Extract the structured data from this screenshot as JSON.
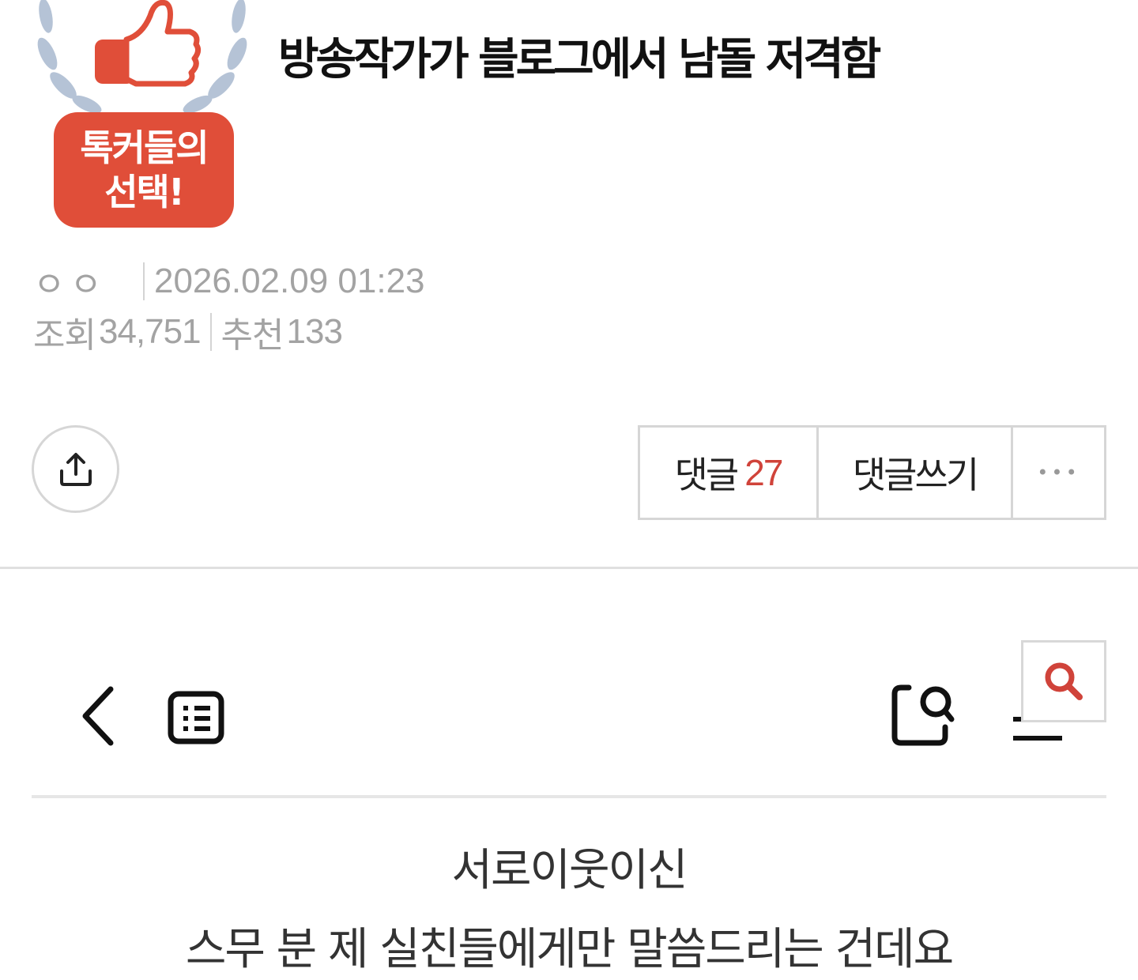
{
  "badge": {
    "line1": "톡커들의",
    "line2": "선택!"
  },
  "post": {
    "title": "방송작가가 블로그에서 남돌 저격함",
    "author": "ㅇㅇ",
    "datetime": "2026.02.09 01:23",
    "views_label": "조회",
    "views": "34,751",
    "recommend_label": "추천",
    "recommends": "133"
  },
  "actions": {
    "comments_label": "댓글",
    "comments_count": "27",
    "write_label": "댓글쓰기",
    "more_label": "•••"
  },
  "embed": {
    "line1": "서로이웃이신",
    "line2": "스무 분 제 실친들에게만 말씀드리는 건데요"
  },
  "colors": {
    "accent": "#d0433a",
    "badge_red": "#e04e39",
    "laurel": "#b5c3d6",
    "meta": "#a3a3a3"
  }
}
